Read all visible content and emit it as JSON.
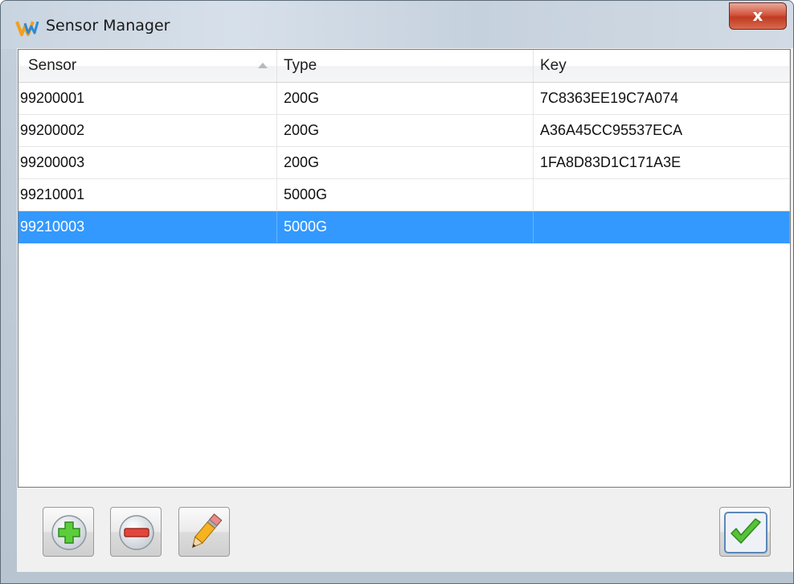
{
  "window": {
    "title": "Sensor Manager",
    "close_label": "x",
    "icon": "app-logo-icon"
  },
  "table": {
    "columns": [
      "Sensor",
      "Type",
      "Key"
    ],
    "sort_column": "Sensor",
    "sort_direction": "ascending",
    "rows": [
      {
        "sensor": "99200001",
        "type": "200G",
        "key": "7C8363EE19C7A074"
      },
      {
        "sensor": "99200002",
        "type": "200G",
        "key": "A36A45CC95537ECA"
      },
      {
        "sensor": "99200003",
        "type": "200G",
        "key": "1FA8D83D1C171A3E"
      },
      {
        "sensor": "99210001",
        "type": "5000G",
        "key": ""
      },
      {
        "sensor": "99210003",
        "type": "5000G",
        "key": ""
      }
    ],
    "selected_row_index": 4,
    "selection_color": "#3399ff"
  },
  "toolbar": {
    "buttons": [
      {
        "name": "add-button",
        "icon": "plus-icon"
      },
      {
        "name": "remove-button",
        "icon": "minus-icon"
      },
      {
        "name": "edit-button",
        "icon": "pencil-icon"
      },
      {
        "name": "ok-button",
        "icon": "checkmark-icon"
      }
    ]
  }
}
